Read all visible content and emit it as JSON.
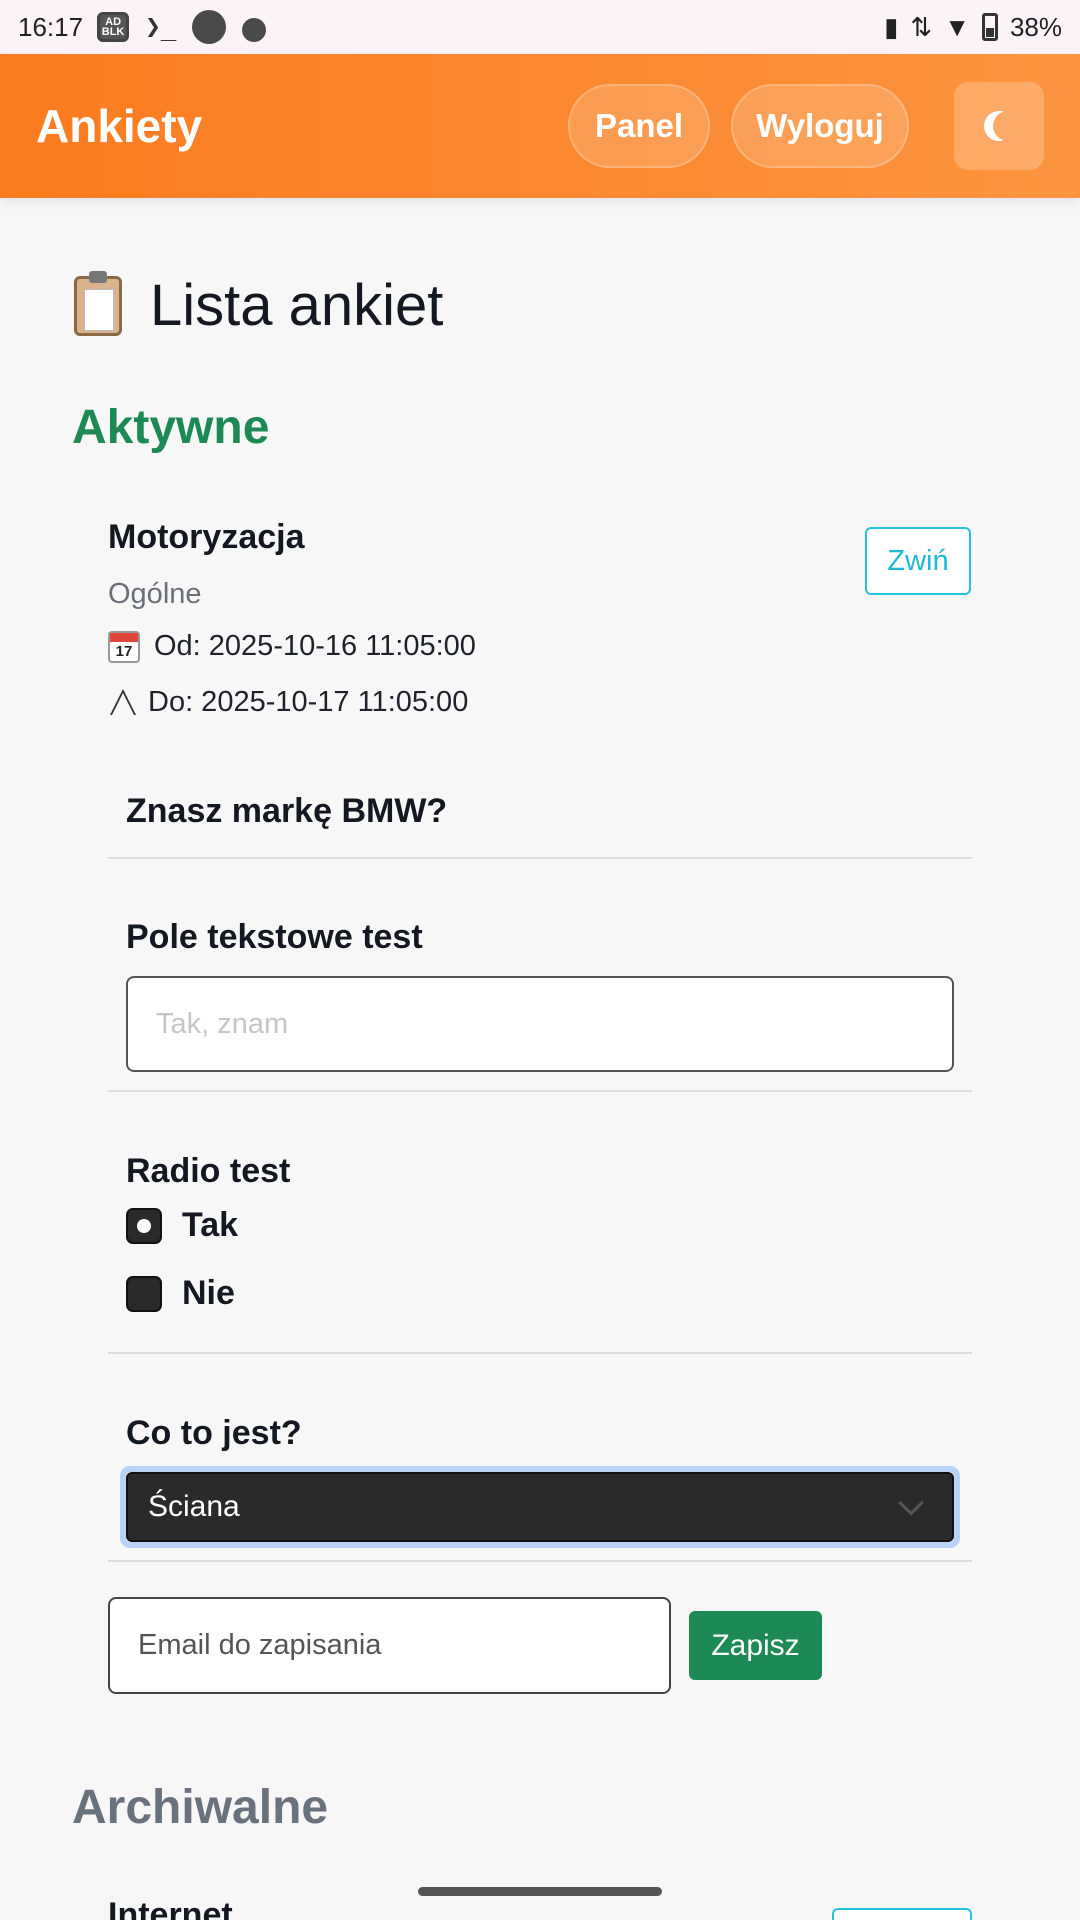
{
  "status_bar": {
    "time": "16:17",
    "ad_icon_text": "AD BLOCKER",
    "terminal_glyph": "❯_",
    "battery": "38%",
    "icons": [
      "adblock-icon",
      "terminal-icon",
      "circle-icon",
      "bomb-icon",
      "vibrate-icon",
      "data-arrows-icon",
      "wifi-icon",
      "battery-icon"
    ]
  },
  "header": {
    "brand": "Ankiety",
    "panel_label": "Panel",
    "logout_label": "Wyloguj",
    "theme_icon": "moon-icon",
    "accent_color": "#fb7b1f"
  },
  "page": {
    "title": "Lista ankiet",
    "title_icon": "clipboard-icon",
    "active_heading": "Aktywne",
    "active_color": "#1d8a55",
    "archive_heading": "Archiwalne"
  },
  "survey": {
    "title": "Motoryzacja",
    "category": "Ogólne",
    "from_label": "Od: 2025-10-16 11:05:00",
    "to_label": "Do: 2025-10-17 11:05:00",
    "collapse_label": "Zwiń",
    "questions": {
      "q1": "Znasz markę BMW?",
      "q2": "Pole tekstowe test",
      "q2_placeholder": "Tak, znam",
      "q3": "Radio test",
      "q3_options": [
        "Tak",
        "Nie"
      ],
      "q3_selected": "Tak",
      "q4": "Co to jest?",
      "q4_selected": "Ściana"
    },
    "email_placeholder": "Email do zapisania",
    "save_label": "Zapisz"
  },
  "archive": {
    "next_title": "Internet"
  }
}
